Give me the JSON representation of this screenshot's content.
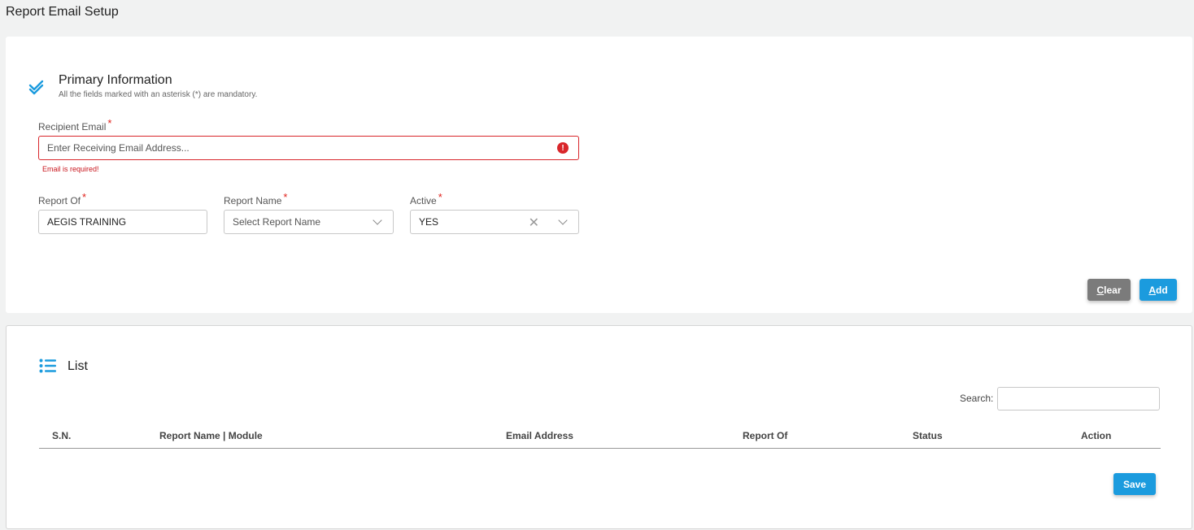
{
  "page": {
    "title": "Report Email Setup"
  },
  "primary": {
    "title": "Primary Information",
    "subtitle": "All the fields marked with an asterisk (*) are mandatory.",
    "recipient_email": {
      "label": "Recipient Email",
      "required": "*",
      "placeholder": "Enter Receiving Email Address...",
      "value": "",
      "error": "Email is required!"
    },
    "report_of": {
      "label": "Report Of",
      "required": "*",
      "value": "AEGIS TRAINING"
    },
    "report_name": {
      "label": "Report Name",
      "required": "*",
      "placeholder": "Select Report Name"
    },
    "active": {
      "label": "Active",
      "required": "*",
      "value": "YES"
    },
    "buttons": {
      "clear_hotkey": "C",
      "clear_rest": "lear",
      "add_hotkey": "A",
      "add_rest": "dd"
    }
  },
  "list": {
    "title": "List",
    "search_label": "Search:",
    "search_value": "",
    "columns": [
      "S.N.",
      "Report Name | Module",
      "Email Address",
      "Report Of",
      "Status",
      "Action"
    ],
    "rows": [],
    "save_label": "Save"
  },
  "colors": {
    "accent": "#1b9bde",
    "error": "#d9262b",
    "clear_button": "#7b7b7b"
  },
  "icons": {
    "primary_section": "double-check-icon",
    "list_section": "list-icon",
    "error": "exclamation-circle-icon"
  }
}
